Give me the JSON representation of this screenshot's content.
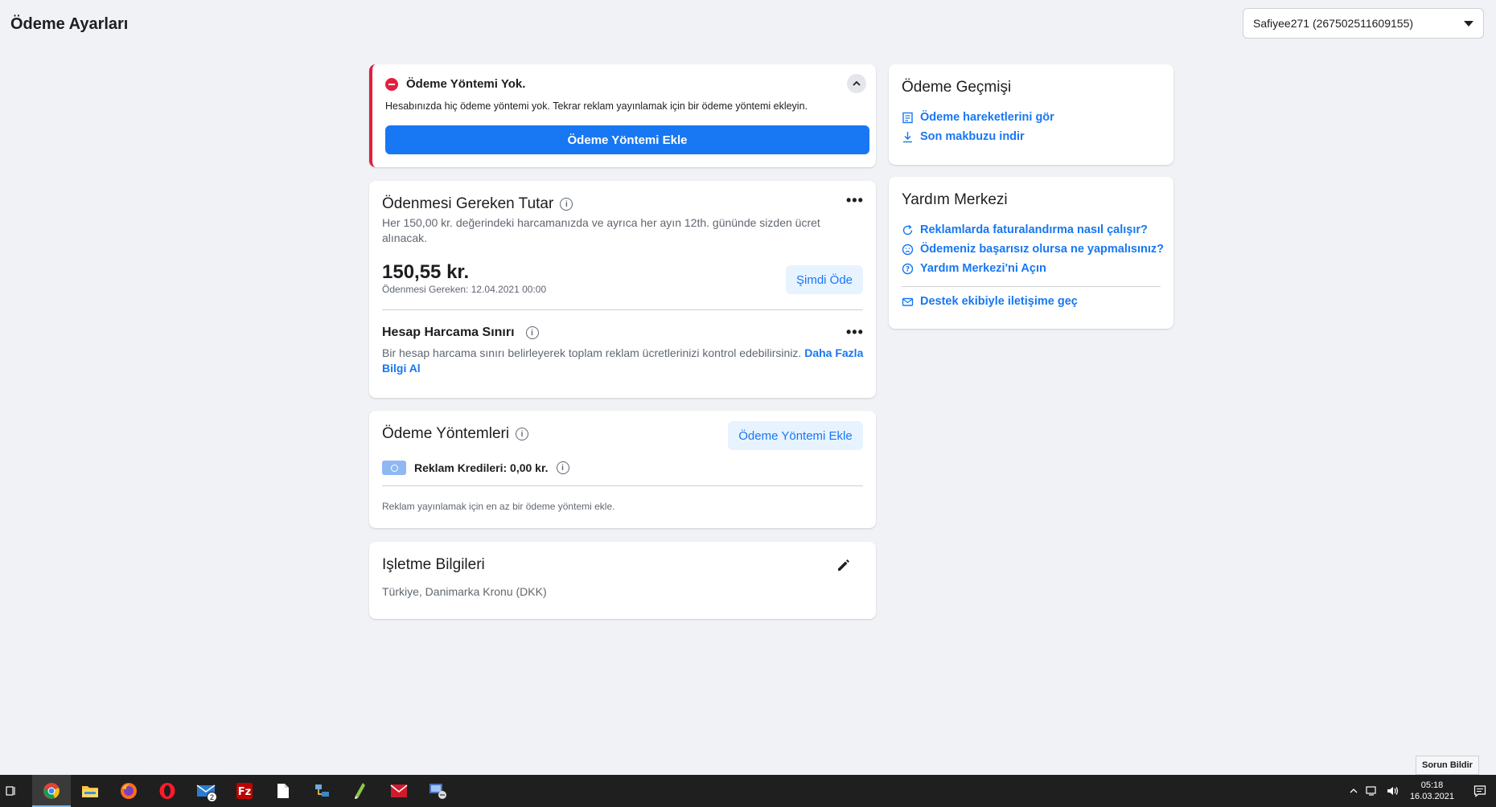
{
  "page": {
    "title": "Ödeme Ayarları"
  },
  "account_selector": {
    "value": "Safiyee271 (267502511609155)"
  },
  "alert": {
    "title": "Ödeme Yöntemi Yok.",
    "description": "Hesabınızda hiç ödeme yöntemi yok. Tekrar reklam yayınlamak için bir ödeme yöntemi ekleyin.",
    "button": "Ödeme Yöntemi Ekle"
  },
  "amount_due": {
    "title": "Ödenmesi Gereken Tutar",
    "description": "Her 150,00 kr. değerindeki harcamanızda ve ayrıca her ayın 12th. gününde sizden ücret alınacak.",
    "amount": "150,55 kr.",
    "due_date": "Ödenmesi Gereken: 12.04.2021 00:00",
    "pay_button": "Şimdi Öde",
    "spending_limit": {
      "title": "Hesap Harcama Sınırı",
      "description": "Bir hesap harcama sınırı belirleyerek toplam reklam ücretlerinizi kontrol edebilirsiniz.",
      "link": "Daha Fazla Bilgi Al"
    }
  },
  "payment_methods": {
    "title": "Ödeme Yöntemleri",
    "add_button": "Ödeme Yöntemi Ekle",
    "credits": "Reklam Kredileri: 0,00 kr.",
    "note": "Reklam yayınlamak için en az bir ödeme yöntemi ekle."
  },
  "business_info": {
    "title": "Işletme Bilgileri",
    "details": "Türkiye, Danimarka Kronu (DKK)"
  },
  "history": {
    "title": "Ödeme Geçmişi",
    "links": [
      "Ödeme hareketlerini gör",
      "Son makbuzu indir"
    ]
  },
  "help_center": {
    "title": "Yardım Merkezi",
    "links": [
      "Reklamlarda faturalandırma nasıl çalışır?",
      "Ödemeniz başarısız olursa ne yapmalısınız?",
      "Yardım Merkezi'ni Açın"
    ],
    "contact": "Destek ekibiyle iletişime geç"
  },
  "report_button": "Sorun Bildir",
  "taskbar": {
    "apps": [
      "task-view-icon",
      "chrome-icon",
      "file-explorer-icon",
      "firefox-icon",
      "opera-icon",
      "mail-icon",
      "filezilla-icon",
      "document-icon",
      "network-tool-icon",
      "notepadpp-icon",
      "mail-client-icon",
      "remote-desktop-icon"
    ],
    "mail_badge": "2",
    "time": "05:18",
    "date": "16.03.2021"
  },
  "colors": {
    "accent": "#1877f2",
    "danger": "#e41e3f",
    "background": "#f0f2f5"
  }
}
